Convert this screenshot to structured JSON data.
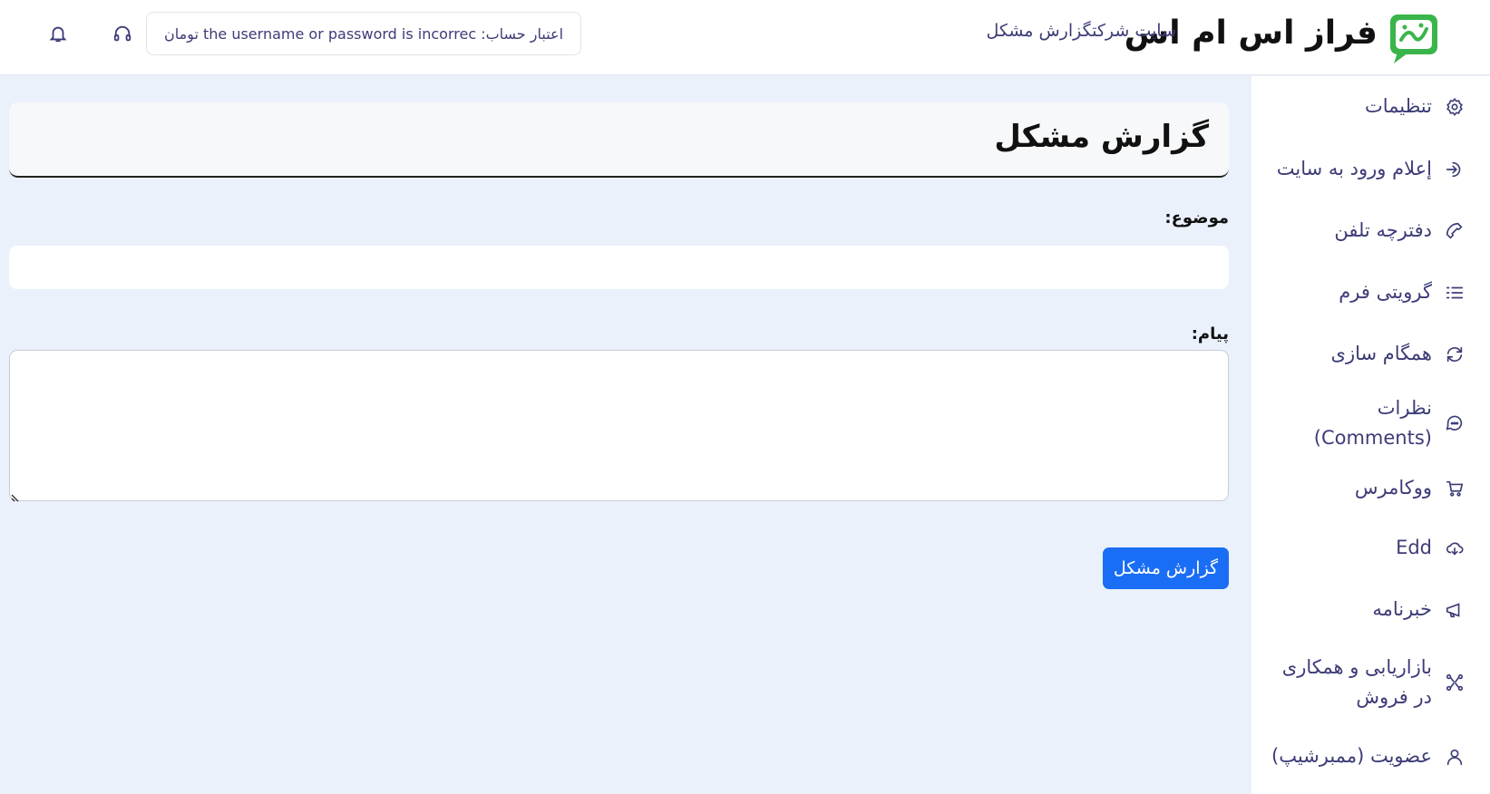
{
  "header": {
    "logo_text": "فراز اس ام اس",
    "logo_icon": "faraz-sms-logo",
    "breadcrumb": "سایت شرکتگزارش مشکل",
    "credit_text": "اعتبار حساب: the username or password is incorrec تومان",
    "support_icon": "headset-icon",
    "notification_icon": "bell-icon"
  },
  "sidebar": {
    "items": [
      {
        "label": "تنظیمات",
        "icon": "gear-icon"
      },
      {
        "label": "إعلام ورود به سایت",
        "icon": "login-icon"
      },
      {
        "label": "دفترچه تلفن",
        "icon": "phone-icon"
      },
      {
        "label": "گرویتی فرم",
        "icon": "list-icon"
      },
      {
        "label": "همگام سازی",
        "icon": "sync-icon"
      },
      {
        "label": "نظرات (Comments)",
        "icon": "comments-icon"
      },
      {
        "label": "ووکامرس",
        "icon": "cart-icon"
      },
      {
        "label": "Edd",
        "icon": "cloud-download-icon"
      },
      {
        "label": "خبرنامه",
        "icon": "megaphone-icon"
      },
      {
        "label": "بازاریابی و همکاری در فروش",
        "icon": "network-icon"
      },
      {
        "label": "عضویت (ممبرشیپ)",
        "icon": "user-icon"
      }
    ]
  },
  "main": {
    "title": "گزارش مشکل",
    "subject_label": "موضوع:",
    "subject_value": "",
    "message_label": "پیام:",
    "message_value": "",
    "submit_label": "گزارش مشکل"
  },
  "colors": {
    "background": "#eaf1fb",
    "text": "#3c3c78",
    "primary_button": "#1a6ef5",
    "logo_green": "#3ab54a"
  }
}
